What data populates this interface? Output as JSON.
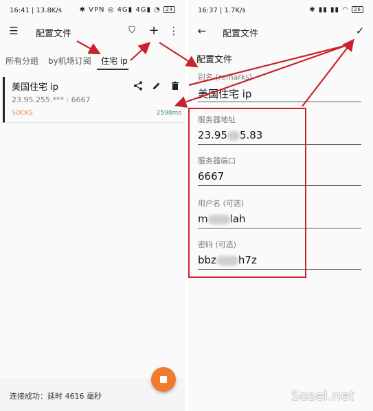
{
  "left": {
    "status": {
      "time": "16:41 | 13.8K/s",
      "icons": "✱ VPN ◎ 4G▮ 4G▮ ◔",
      "battery": "24"
    },
    "toolbar": {
      "title": "配置文件",
      "menu_icon": "☰",
      "filter_icon": "⛉",
      "add_icon": "+",
      "more_icon": "⋮"
    },
    "tabs": [
      "所有分组",
      "by机场订阅",
      "住宅 ip"
    ],
    "active_tab": 2,
    "card": {
      "name": "美国住宅 ip",
      "address": "23.95.255.*** : 6667",
      "protocol": "SOCKS",
      "latency": "2598ms",
      "share_icon": "share",
      "edit_icon": "edit",
      "delete_icon": "delete"
    },
    "footer": {
      "message": "连接成功：延时 4616 毫秒"
    },
    "fab_icon": "stop"
  },
  "right": {
    "status": {
      "time": "16:37 | 1.7K/s",
      "icons": "✱ ▮▮ ▮▮ ◠",
      "battery": "26"
    },
    "toolbar": {
      "title": "配置文件",
      "back_icon": "←",
      "save_icon": "✓"
    },
    "section_title": "配置文件",
    "fields": {
      "remarks": {
        "label": "别名 (remarks)",
        "value": "美国住宅 ip"
      },
      "server": {
        "label": "服务器地址",
        "value_pre": "23.95",
        "value_post": "5.83"
      },
      "port": {
        "label": "服务器端口",
        "value": "6667"
      },
      "username": {
        "label": "用户名 (可选)",
        "value_pre": "m",
        "value_post": "lah"
      },
      "password": {
        "label": "密码 (可选)",
        "value_pre": "bbz",
        "value_post": "h7z"
      }
    }
  },
  "watermark": "Sosel.net",
  "colors": {
    "accent": "#f07b2c",
    "latency": "#3a9a5a",
    "annotation": "#c8232c"
  }
}
